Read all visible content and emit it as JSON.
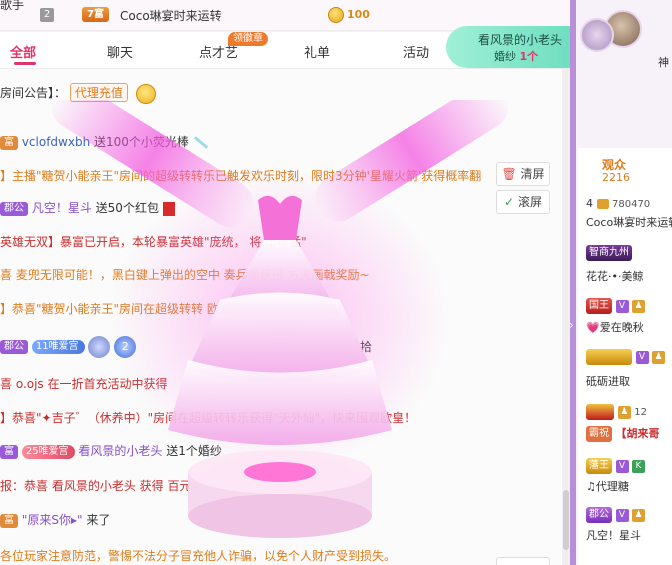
{
  "rank_strip": {
    "top_title": "歌手",
    "rank_num": "2",
    "fu_badge": "7富",
    "user": "Coco琳宴时来运转",
    "coins": "100"
  },
  "tabs": [
    {
      "label": "全部",
      "active": true
    },
    {
      "label": "聊天"
    },
    {
      "label": "点才艺",
      "tag": "领徽章"
    },
    {
      "label": "礼单"
    },
    {
      "label": "活动"
    }
  ],
  "chat": {
    "announcement": "房间公告】：",
    "announcement_tag": "代理充值",
    "lines": [
      {
        "badge": "富",
        "user": "vclofdwxbh",
        "text": "送100个小荧光棒"
      },
      {
        "text": "】主播\"糖贺小能亲王\"房间的超级转转乐已触发欢乐时刻，限时3分钟'星耀火箭'获得概率翻"
      },
      {
        "badge": "郡公",
        "user": "凡空！星斗",
        "text": "送50个红包"
      },
      {
        "text": "英雄无双】暴富已开启，本轮暴富英雄\"庞统，      将     士卒猛\""
      },
      {
        "text": "喜 麦兜无限可能！，黑白键上弹出的空中                  奏兵阁获得 方天画戟奖励~"
      },
      {
        "text": "】恭喜\"糖贺小能亲王\"房间在超级转转                           欧皇！"
      },
      {
        "badge": "郡公",
        "pill": "11唯爱宫",
        "text": "拾"
      },
      {
        "text": "喜 o.ojs 在一折首充活动中获得"
      },
      {
        "text": "】恭喜\"✦吉子゛（休养中）\"房间在超级转转乐获得\"天外仙\"，快来围观欧皇！"
      },
      {
        "badge": "富",
        "pill": "25唯爱宫",
        "user": "看风景的小老头",
        "text": "送1个婚纱"
      },
      {
        "text": "报：恭喜 看风景的小老头 获得 百元"
      },
      {
        "badge": "富",
        "user": "\"原来S你▸\"",
        "text": "来了"
      },
      {
        "text": "各位玩家注意防范，警惕不法分子冒充他人诈骗，以免个人财产受到损失。"
      }
    ],
    "clear_button": "清屏",
    "scroll_button": "滚屏"
  },
  "gift_banner": {
    "title": "看风景的小老头",
    "gift": "婚纱",
    "count": "1个"
  },
  "right_panel": {
    "host_name": "神",
    "audience_label": "观众",
    "audience_count": "2216",
    "entries": [
      {
        "level": "4",
        "score": "780470",
        "name": "Coco琳宴时来运转"
      },
      {
        "medal": "智商九州",
        "name": "花花·•·美鲸"
      },
      {
        "medal": "国王",
        "name": "💗爱在晚秋"
      },
      {
        "medal": "",
        "name": "砥砺进取"
      },
      {
        "medal": "霸祝",
        "score": "12",
        "name": "【胡来哥"
      },
      {
        "medal": "藩王",
        "name": "♫代理糖"
      },
      {
        "medal": "郡公",
        "name": "凡空！星斗"
      }
    ]
  },
  "colors": {
    "accent": "#e0336b",
    "banner": "#57d4b4",
    "divider": "#b990d8"
  }
}
